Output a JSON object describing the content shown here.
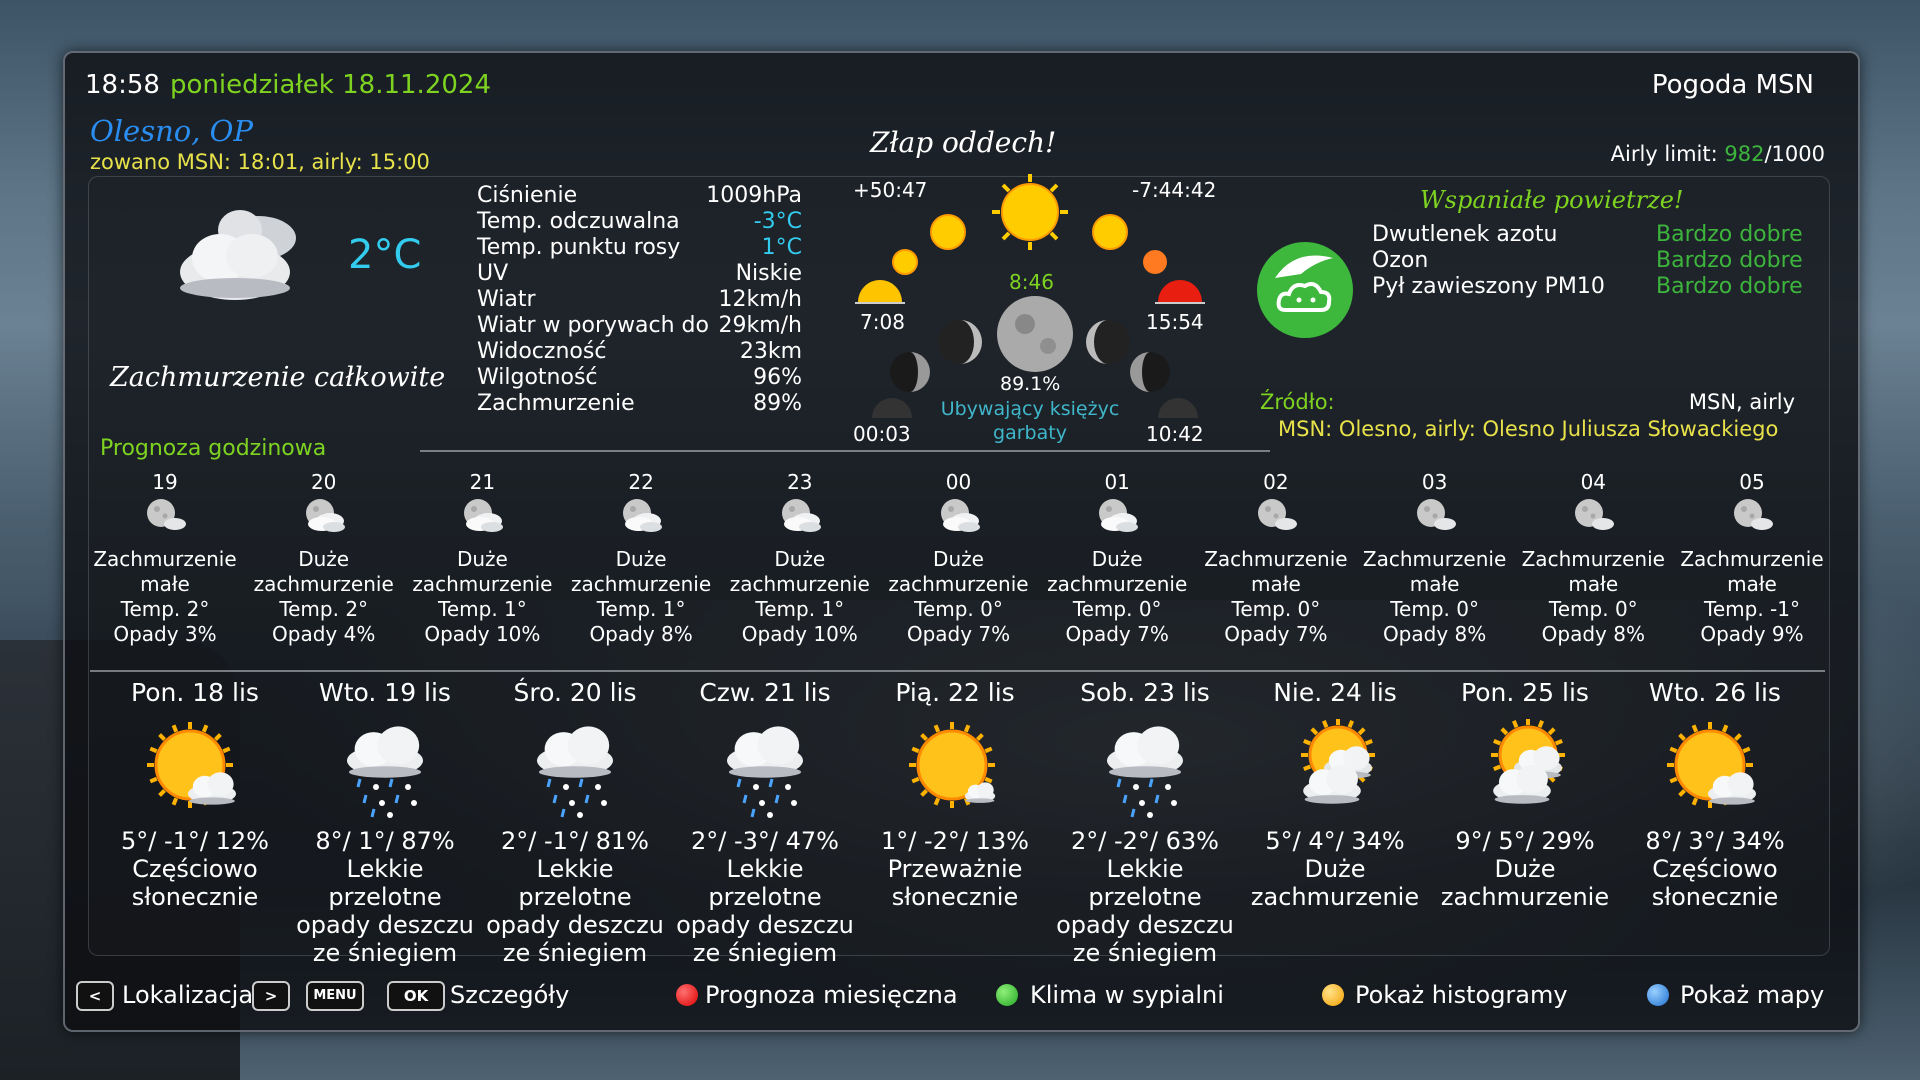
{
  "header": {
    "time": "18:58",
    "date": "poniedziałek 18.11.2024",
    "title": "Pogoda MSN",
    "location": "Olesno, OP",
    "updated": "zowano MSN: 18:01, airly: 15:00",
    "slogan": "Złap oddech!",
    "airly_limit_label": "Airly limit:",
    "airly_used": "982",
    "airly_total": "/1000"
  },
  "current": {
    "temperature": "2°C",
    "description": "Zachmurzenie całkowite",
    "details": [
      {
        "label": "Ciśnienie",
        "value": "1009hPa",
        "color": "#ffffff"
      },
      {
        "label": "Temp. odczuwalna",
        "value": "-3°C",
        "color": "#33ccee"
      },
      {
        "label": "Temp. punktu rosy",
        "value": "1°C",
        "color": "#33ccee"
      },
      {
        "label": "UV",
        "value": "Niskie",
        "color": "#ffffff"
      },
      {
        "label": "Wiatr",
        "value": "12km/h",
        "color": "#ffffff"
      },
      {
        "label": "Wiatr w porywach do",
        "value": "29km/h",
        "color": "#ffffff"
      },
      {
        "label": "Widoczność",
        "value": "23km",
        "color": "#ffffff"
      },
      {
        "label": "Wilgotność",
        "value": "96%",
        "color": "#ffffff"
      },
      {
        "label": "Zachmurzenie",
        "value": "89%",
        "color": "#ffffff"
      }
    ]
  },
  "astro": {
    "day_delta": "+50:47",
    "night_delta": "-7:44:42",
    "sunrise": "7:08",
    "noon": "8:46",
    "sunset": "15:54",
    "moon_percent": "89.1%",
    "moon_phase": "Ubywający księżyc",
    "moon_phase2": "garbaty",
    "moonrise": "00:03",
    "moonset": "10:42"
  },
  "air": {
    "headline": "Wspaniałe powietrze!",
    "items": [
      {
        "label": "Dwutlenek azotu",
        "value": "Bardzo dobre"
      },
      {
        "label": "Ozon",
        "value": "Bardzo dobre"
      },
      {
        "label": "Pył zawieszony PM10",
        "value": "Bardzo dobre"
      }
    ],
    "source_label": "Źródło:",
    "source_value": "MSN, airly",
    "source_detail": "MSN: Olesno, airly: Olesno Juliusza Słowackiego"
  },
  "hourly": {
    "title": "Prognoza godzinowa",
    "items": [
      {
        "hour": "19",
        "desc1": "Zachmurzenie",
        "desc2": "małe",
        "temp": "Temp. 2°",
        "precip": "Opady 3%",
        "icon": "moon-cloud-icon"
      },
      {
        "hour": "20",
        "desc1": "Duże",
        "desc2": "zachmurzenie",
        "temp": "Temp. 2°",
        "precip": "Opady 4%",
        "icon": "moon-clouds-icon"
      },
      {
        "hour": "21",
        "desc1": "Duże",
        "desc2": "zachmurzenie",
        "temp": "Temp. 1°",
        "precip": "Opady 10%",
        "icon": "moon-clouds-icon"
      },
      {
        "hour": "22",
        "desc1": "Duże",
        "desc2": "zachmurzenie",
        "temp": "Temp. 1°",
        "precip": "Opady 8%",
        "icon": "moon-clouds-icon"
      },
      {
        "hour": "23",
        "desc1": "Duże",
        "desc2": "zachmurzenie",
        "temp": "Temp. 1°",
        "precip": "Opady 10%",
        "icon": "moon-clouds-icon"
      },
      {
        "hour": "00",
        "desc1": "Duże",
        "desc2": "zachmurzenie",
        "temp": "Temp. 0°",
        "precip": "Opady 7%",
        "icon": "moon-clouds-icon"
      },
      {
        "hour": "01",
        "desc1": "Duże",
        "desc2": "zachmurzenie",
        "temp": "Temp. 0°",
        "precip": "Opady 7%",
        "icon": "moon-clouds-icon"
      },
      {
        "hour": "02",
        "desc1": "Zachmurzenie",
        "desc2": "małe",
        "temp": "Temp. 0°",
        "precip": "Opady 7%",
        "icon": "moon-cloud-icon"
      },
      {
        "hour": "03",
        "desc1": "Zachmurzenie",
        "desc2": "małe",
        "temp": "Temp. 0°",
        "precip": "Opady 8%",
        "icon": "moon-cloud-icon"
      },
      {
        "hour": "04",
        "desc1": "Zachmurzenie",
        "desc2": "małe",
        "temp": "Temp. 0°",
        "precip": "Opady 8%",
        "icon": "moon-cloud-icon"
      },
      {
        "hour": "05",
        "desc1": "Zachmurzenie",
        "desc2": "małe",
        "temp": "Temp. -1°",
        "precip": "Opady 9%",
        "icon": "moon-cloud-icon"
      }
    ]
  },
  "daily": [
    {
      "day": "Pon. 18 lis",
      "temps": "5°/ -1°/ 12%",
      "d1": "Częściowo",
      "d2": "słonecznie",
      "d3": "",
      "icon": "sun-cloud-icon"
    },
    {
      "day": "Wto. 19 lis",
      "temps": "8°/ 1°/ 87%",
      "d1": "Lekkie przelotne",
      "d2": "opady deszczu",
      "d3": "ze śniegiem",
      "icon": "sleet-icon"
    },
    {
      "day": "Śro. 20 lis",
      "temps": "2°/ -1°/ 81%",
      "d1": "Lekkie przelotne",
      "d2": "opady deszczu",
      "d3": "ze śniegiem",
      "icon": "sleet-icon"
    },
    {
      "day": "Czw. 21 lis",
      "temps": "2°/ -3°/ 47%",
      "d1": "Lekkie przelotne",
      "d2": "opady deszczu",
      "d3": "ze śniegiem",
      "icon": "sleet-icon"
    },
    {
      "day": "Pią. 22 lis",
      "temps": "1°/ -2°/ 13%",
      "d1": "Przeważnie",
      "d2": "słonecznie",
      "d3": "",
      "icon": "sun-small-cloud-icon"
    },
    {
      "day": "Sob. 23 lis",
      "temps": "2°/ -2°/ 63%",
      "d1": "Lekkie przelotne",
      "d2": "opady deszczu",
      "d3": "ze śniegiem",
      "icon": "sleet-icon"
    },
    {
      "day": "Nie. 24 lis",
      "temps": "5°/ 4°/ 34%",
      "d1": "Duże",
      "d2": "zachmurzenie",
      "d3": "",
      "icon": "sun-clouds-icon"
    },
    {
      "day": "Pon. 25 lis",
      "temps": "9°/ 5°/ 29%",
      "d1": "Duże",
      "d2": "zachmurzenie",
      "d3": "",
      "icon": "sun-clouds-icon"
    },
    {
      "day": "Wto. 26 lis",
      "temps": "8°/ 3°/ 34%",
      "d1": "Częściowo",
      "d2": "słonecznie",
      "d3": "",
      "icon": "sun-cloud-icon"
    }
  ],
  "footer": {
    "key_prev": "<",
    "key_next": ">",
    "location_label": "Lokalizacja",
    "key_menu": "MENU",
    "key_ok": "OK",
    "details_label": "Szczegóły",
    "red_label": "Prognoza miesięczna",
    "green_label": "Klima w sypialni",
    "yellow_label": "Pokaż histogramy",
    "blue_label": "Pokaż mapy"
  },
  "colors": {
    "accent_green": "#7ed321",
    "air_good": "#3db53d",
    "cold_cyan": "#33ccee",
    "source_yellow": "#e8e24a",
    "location_blue": "#2a8df0"
  }
}
